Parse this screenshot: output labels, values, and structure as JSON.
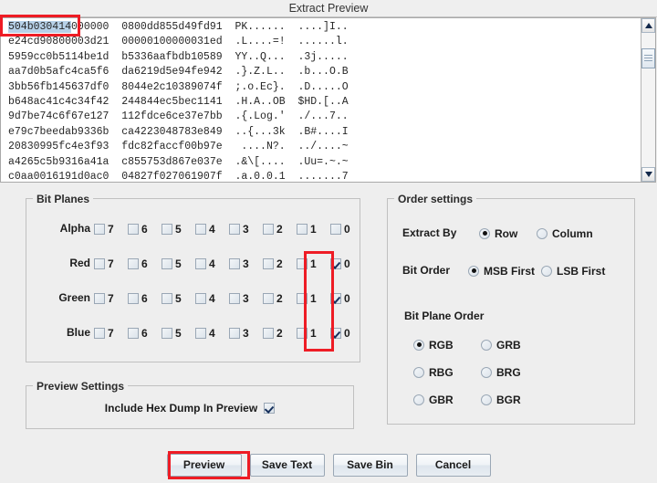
{
  "dialog": {
    "title": "Extract Preview"
  },
  "preview": {
    "hex_lines": [
      {
        "sel": "504b030414",
        "rest": "000000  0800dd855d49fd91  PK......  ....]I.."
      },
      {
        "sel": "",
        "rest": "e24cd90800003d21  00000100000031ed  .L....=!  ......l."
      },
      {
        "sel": "",
        "rest": "5959cc0b5114be1d  b5336aafbdb10589  YY..Q...  .3j....."
      },
      {
        "sel": "",
        "rest": "aa7d0b5afc4ca5f6  da6219d5e94fe942  .}.Z.L..  .b...O.B"
      },
      {
        "sel": "",
        "rest": "3bb56fb145637df0  8044e2c10389074f  ;.o.Ec}.  .D.....O"
      },
      {
        "sel": "",
        "rest": "b648ac41c4c34f42  244844ec5bec1141  .H.A..OB  $HD.[..A"
      },
      {
        "sel": "",
        "rest": "9d7be74c6f67e127  112fdce6ce37e7bb  .{.Log.'  ./...7.."
      },
      {
        "sel": "",
        "rest": "e79c7beedab9336b  ca4223048783e849  ..{...3k  .B#....I"
      },
      {
        "sel": "",
        "rest": "20830995fc4e3f93  fdc82faccf00b97e   ....N?.  ../....~"
      },
      {
        "sel": "",
        "rest": "a4265c5b9316a41a  c855753d867e037e  .&\\[....  .Uu=.~.~"
      },
      {
        "sel": "",
        "rest": "c0aa0016191d0ac0  04827f027061907f  .a.0.0.1  .......7"
      }
    ],
    "scrollbar": {
      "up_arrow": "scroll-up",
      "down_arrow": "scroll-down"
    }
  },
  "bit_planes": {
    "title": "Bit Planes",
    "bit_labels": [
      "7",
      "6",
      "5",
      "4",
      "3",
      "2",
      "1",
      "0"
    ],
    "rows": [
      {
        "channel": "Alpha",
        "checked": [
          false,
          false,
          false,
          false,
          false,
          false,
          false,
          false
        ]
      },
      {
        "channel": "Red",
        "checked": [
          false,
          false,
          false,
          false,
          false,
          false,
          false,
          true
        ]
      },
      {
        "channel": "Green",
        "checked": [
          false,
          false,
          false,
          false,
          false,
          false,
          false,
          true
        ]
      },
      {
        "channel": "Blue",
        "checked": [
          false,
          false,
          false,
          false,
          false,
          false,
          false,
          true
        ]
      }
    ]
  },
  "order_settings": {
    "title": "Order settings",
    "extract_by": {
      "label": "Extract By",
      "options": [
        "Row",
        "Column"
      ],
      "selected": "Row"
    },
    "bit_order": {
      "label": "Bit Order",
      "options": [
        "MSB First",
        "LSB First"
      ],
      "selected": "MSB First"
    },
    "bit_plane_order": {
      "label": "Bit Plane Order",
      "options": [
        "RGB",
        "GRB",
        "RBG",
        "BRG",
        "GBR",
        "BGR"
      ],
      "selected": "RGB"
    }
  },
  "preview_settings": {
    "title": "Preview Settings",
    "include_hex_dump": {
      "label": "Include Hex Dump In Preview",
      "checked": true
    }
  },
  "buttons": [
    {
      "label": "Preview"
    },
    {
      "label": "Save Text"
    },
    {
      "label": "Save Bin"
    },
    {
      "label": "Cancel"
    }
  ],
  "annotations": {
    "accent_color": "#ee1c25",
    "highlight_color": "#b7d1e8",
    "boxes": [
      "hex-magic-bytes",
      "bit-plane-0-column",
      "preview-button"
    ]
  }
}
